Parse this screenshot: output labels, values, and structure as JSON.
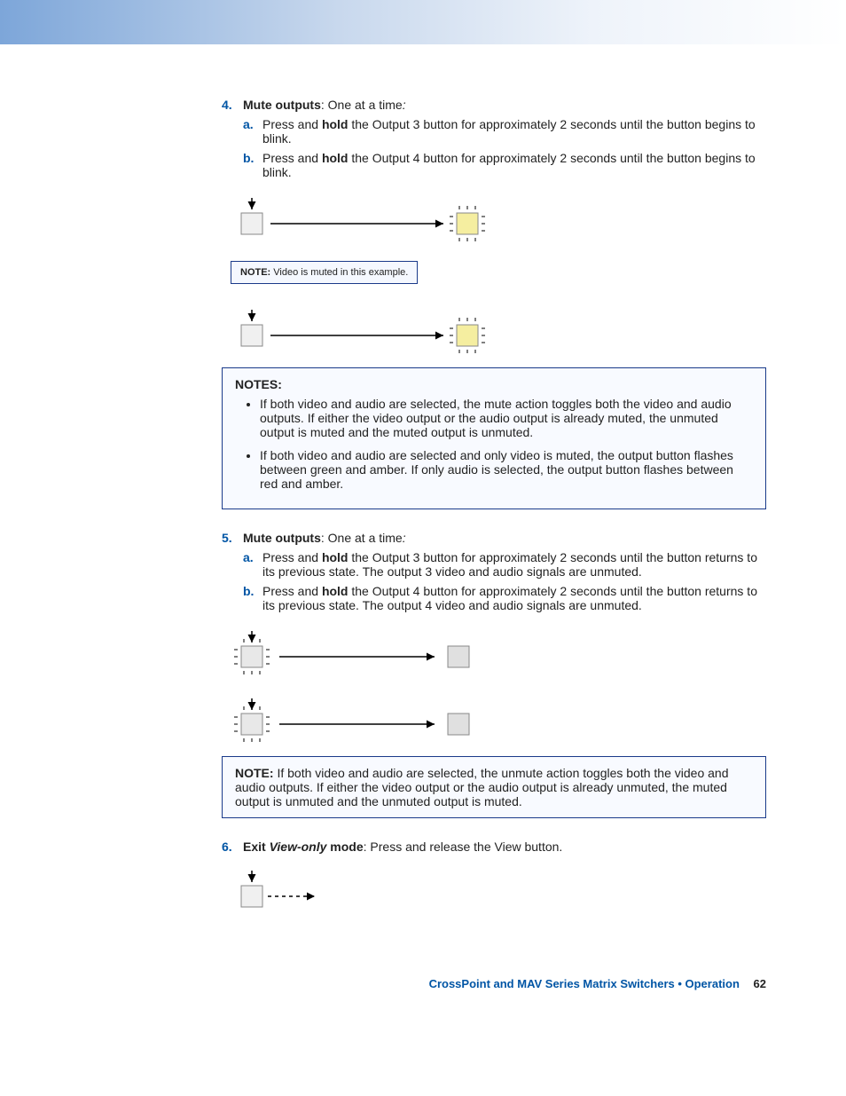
{
  "step4": {
    "num": "4.",
    "title_bold": "Mute outputs",
    "title_rest": ": One at a time",
    "colon": ":",
    "a": {
      "num": "a.",
      "pre": "Press and ",
      "bold": "hold",
      "post": " the Output 3 button for approximately 2 seconds until the button begins to blink."
    },
    "b": {
      "num": "b.",
      "pre": "Press and ",
      "bold": "hold",
      "post": " the Output 4 button for approximately 2 seconds until the button begins to blink."
    },
    "inline_note": {
      "label": "NOTE:",
      "text": "  Video is muted in this example."
    }
  },
  "notes_box": {
    "title": "NOTES:",
    "items": [
      "If both video and audio are selected, the mute action toggles both the video and audio outputs. If either the video output or the audio output is already muted, the unmuted output is muted and the muted output is unmuted.",
      "If both video and audio are selected and only video is muted, the output button flashes between green and amber. If only audio is selected, the output button flashes between red and amber."
    ]
  },
  "step5": {
    "num": "5.",
    "title_bold": "Mute outputs",
    "title_rest": ": One at a time",
    "colon": ":",
    "a": {
      "num": "a.",
      "pre": "Press and ",
      "bold": "hold",
      "post": " the Output 3 button for approximately 2 seconds until the button returns to its previous state. The output 3 video and audio signals are unmuted."
    },
    "b": {
      "num": "b.",
      "pre": "Press and ",
      "bold": "hold",
      "post": " the Output 4 button for approximately 2 seconds until the button returns to its previous state. The output 4 video and audio signals are unmuted."
    }
  },
  "note_box2": {
    "label": "NOTE:",
    "text": "   If both video and audio are selected, the unmute action toggles both the video and audio outputs. If either the video output or the audio output is already unmuted, the muted output is unmuted and the unmuted output is muted."
  },
  "step6": {
    "num": "6.",
    "bold1": "Exit ",
    "italic": "View-only",
    "bold2": " mode",
    "rest": ": Press and release the View button."
  },
  "footer": {
    "blue": "CrossPoint and MAV Series Matrix Switchers • Operation",
    "page": "62"
  }
}
